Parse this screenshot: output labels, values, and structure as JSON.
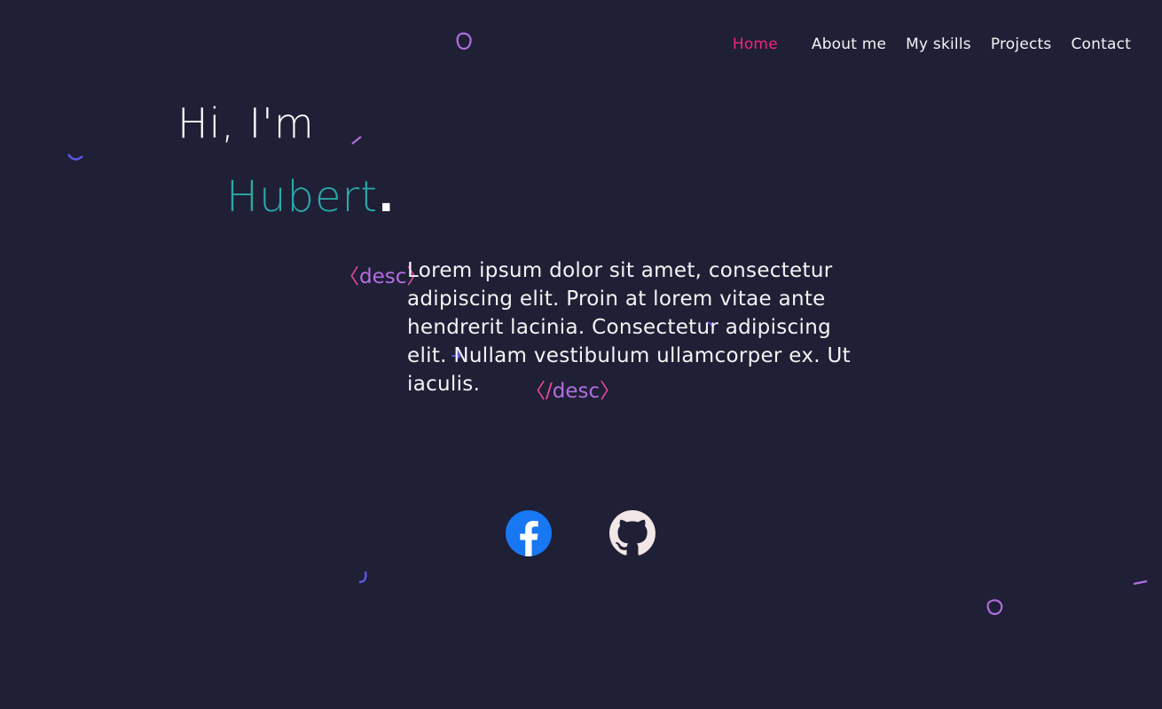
{
  "nav": {
    "items": [
      {
        "label": "Home",
        "active": true
      },
      {
        "label": "About me",
        "active": false
      },
      {
        "label": "My skills",
        "active": false
      },
      {
        "label": "Projects",
        "active": false
      },
      {
        "label": "Contact",
        "active": false
      }
    ]
  },
  "hero": {
    "greeting": "Hi, I'm",
    "name": "Hubert",
    "name_suffix": "."
  },
  "description": {
    "open_tag_name": "desc",
    "close_tag_name": "desc",
    "text": "Lorem ipsum dolor sit amet, consectetur adipiscing elit. Proin at lorem vitae ante hendrerit lacinia. Consectetur adipiscing elit. Nullam vestibulum ullamcorper ex. Ut iaculis."
  },
  "social": {
    "facebook_icon": "facebook-icon",
    "github_icon": "github-icon"
  },
  "colors": {
    "background": "#1f1f36",
    "accent_pink": "#f0257a",
    "teal": "#2aa8a8",
    "purple": "#b26ee0",
    "facebook_blue": "#1877f2"
  }
}
